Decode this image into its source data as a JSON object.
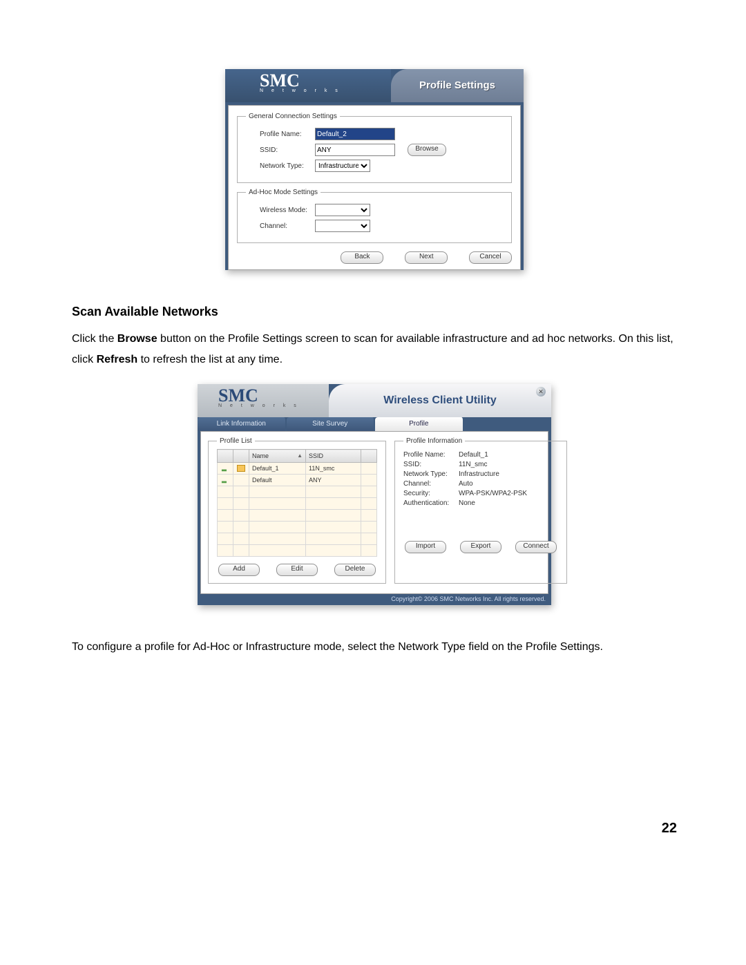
{
  "screenshot1": {
    "brand": "SMC",
    "brand_sub": "N e t w o r k s",
    "title": "Profile Settings",
    "group1_legend": "General Connection Settings",
    "profile_name_label": "Profile Name:",
    "profile_name_value": "Default_2",
    "ssid_label": "SSID:",
    "ssid_value": "ANY",
    "browse_btn": "Browse",
    "nettype_label": "Network Type:",
    "nettype_value": "Infrastructure",
    "group2_legend": "Ad-Hoc Mode Settings",
    "wmode_label": "Wireless Mode:",
    "wmode_value": "",
    "channel_label": "Channel:",
    "channel_value": "",
    "back_btn": "Back",
    "next_btn": "Next",
    "cancel_btn": "Cancel"
  },
  "text1": {
    "heading": "Scan Available Networks",
    "para": {
      "pre": "Click the ",
      "b1": "Browse",
      "mid": " button on the Profile Settings screen to scan for available infrastructure and ad hoc networks. On this list, click ",
      "b2": "Refresh",
      "post": " to refresh the list at any time."
    }
  },
  "screenshot2": {
    "brand": "SMC",
    "brand_sub": "N e t w o r k s",
    "title": "Wireless Client Utility",
    "tabs": {
      "t1": "Link Information",
      "t2": "Site Survey",
      "t3": "Profile"
    },
    "list_legend": "Profile List",
    "col_name": "Name",
    "col_ssid": "SSID",
    "rows": [
      {
        "name": "Default_1",
        "ssid": "11N_smc"
      },
      {
        "name": "Default",
        "ssid": "ANY"
      }
    ],
    "info_legend": "Profile Information",
    "info": {
      "pn_k": "Profile Name:",
      "pn_v": "Default_1",
      "ss_k": "SSID:",
      "ss_v": "11N_smc",
      "nt_k": "Network Type:",
      "nt_v": "Infrastructure",
      "ch_k": "Channel:",
      "ch_v": "Auto",
      "se_k": "Security:",
      "se_v": "WPA-PSK/WPA2-PSK",
      "au_k": "Authentication:",
      "au_v": "None"
    },
    "btns": {
      "add": "Add",
      "edit": "Edit",
      "delete": "Delete",
      "import": "Import",
      "export": "Export",
      "connect": "Connect"
    },
    "copyright": "Copyright© 2006 SMC Networks Inc. All rights reserved."
  },
  "text2": {
    "para": "To configure a profile for Ad-Hoc or Infrastructure mode, select the Network Type field on the Profile Settings."
  },
  "pagenum": "22"
}
